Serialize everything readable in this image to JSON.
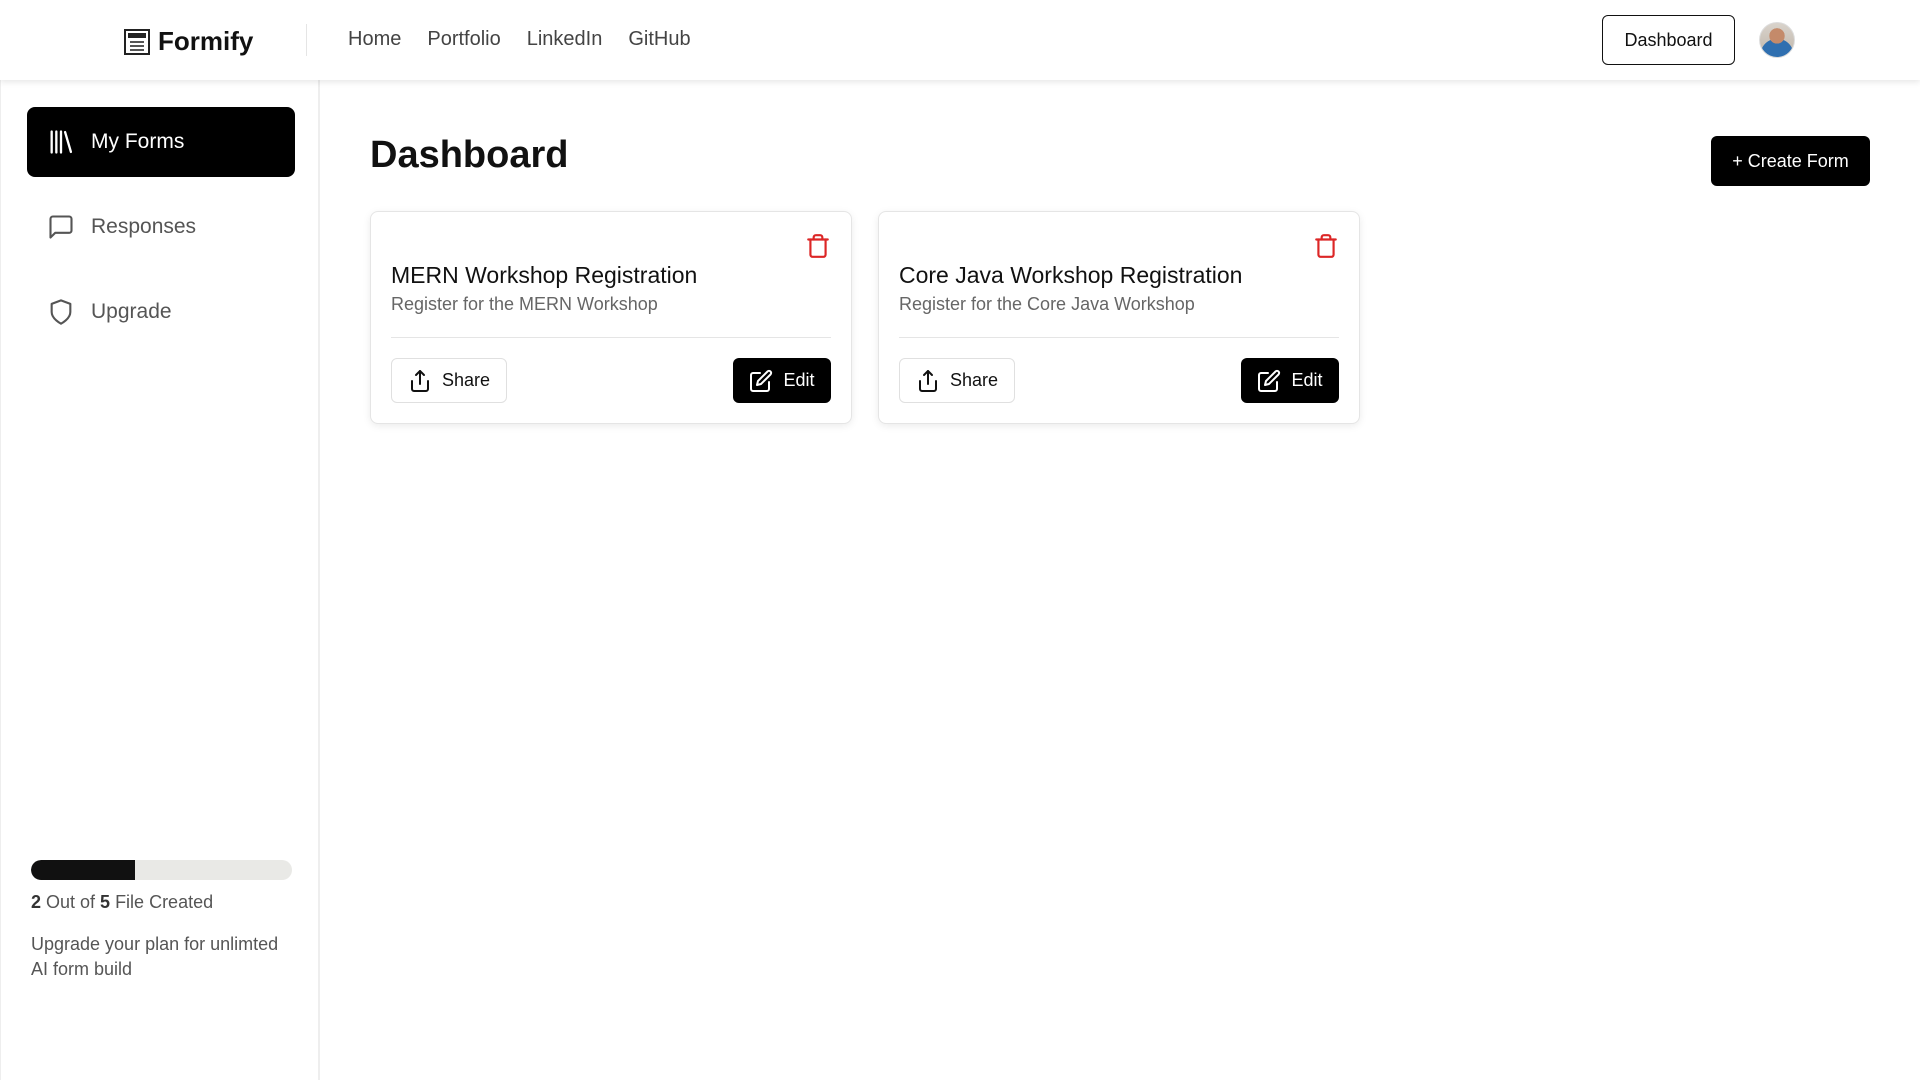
{
  "header": {
    "brand": "Formify",
    "nav": [
      "Home",
      "Portfolio",
      "LinkedIn",
      "GitHub"
    ],
    "dashboard_button": "Dashboard"
  },
  "sidebar": {
    "items": [
      {
        "label": "My Forms",
        "icon": "library-icon",
        "active": true
      },
      {
        "label": "Responses",
        "icon": "message-square-icon",
        "active": false
      },
      {
        "label": "Upgrade",
        "icon": "shield-icon",
        "active": false
      }
    ],
    "usage": {
      "created": "2",
      "limit": "5",
      "progress_fraction": 0.4,
      "text_middle": " Out of ",
      "text_suffix": " File Created"
    },
    "upgrade_note": "Upgrade your plan for unlimted AI form build"
  },
  "main": {
    "title": "Dashboard",
    "create_button": "+ Create Form",
    "cards": [
      {
        "title": "MERN Workshop Registration",
        "description": "Register for the MERN Workshop",
        "share_label": "Share",
        "edit_label": "Edit"
      },
      {
        "title": "Core Java Workshop Registration",
        "description": "Register for the Core Java Workshop",
        "share_label": "Share",
        "edit_label": "Edit"
      }
    ]
  },
  "colors": {
    "accent": "#000000",
    "delete": "#dc2626",
    "muted_text": "#666666"
  }
}
